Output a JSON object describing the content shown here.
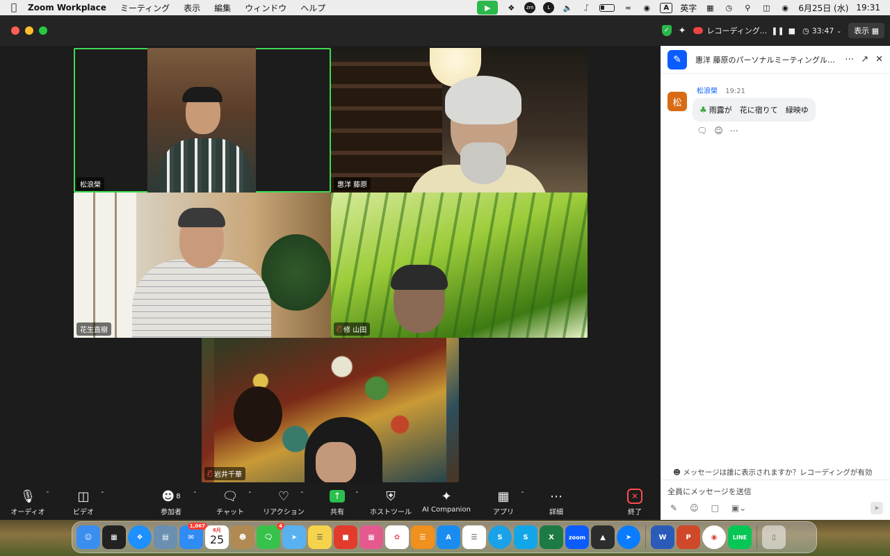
{
  "menubar": {
    "app_name": "Zoom Workplace",
    "menus": [
      "ミーティング",
      "表示",
      "編集",
      "ウィンドウ",
      "ヘルプ"
    ],
    "input_mode": "英字",
    "date": "6月25日 (水)",
    "time": "19:31"
  },
  "titlebar": {
    "recording_label": "レコーディング...",
    "timer": "33:47",
    "view_label": "表示"
  },
  "participants": [
    {
      "name": "松浪榮",
      "muted": false,
      "active_speaker": true
    },
    {
      "name": "惠洋 藤原",
      "muted": false,
      "active_speaker": false
    },
    {
      "name": "花生直樹",
      "muted": false,
      "active_speaker": false
    },
    {
      "name": "修 山田",
      "muted": true,
      "active_speaker": false
    },
    {
      "name": "岩井千華",
      "muted": true,
      "active_speaker": false
    }
  ],
  "toolbar": {
    "audio": "オーディオ",
    "video": "ビデオ",
    "participants": "参加者",
    "participant_count": "8",
    "chat": "チャット",
    "reactions": "リアクション",
    "share": "共有",
    "host_tools": "ホストツール",
    "ai_companion": "AI Companion",
    "apps": "アプリ",
    "details": "詳細",
    "end": "終了"
  },
  "chat": {
    "title": "惠洋 藤原のパーソナルミーティングル…",
    "messages": [
      {
        "avatar": "松",
        "sender": "松浪榮",
        "time": "19:21",
        "text": "雨露が　花に宿りて　緑映ゆ"
      }
    ],
    "privacy_notice": "メッセージは誰に表示されますか？レコーディングが有効",
    "input_placeholder": "全員にメッセージを送信"
  },
  "dock": {
    "mail_badge": "1,067",
    "messages_badge": "4",
    "calendar_month": "6月",
    "calendar_day": "25",
    "zoom_label": "zoom"
  },
  "colors": {
    "active_speaker": "#3ddc52",
    "zoom_blue": "#0b5cff",
    "end_red": "#ff4d4d",
    "share_green": "#2bbf4e"
  }
}
